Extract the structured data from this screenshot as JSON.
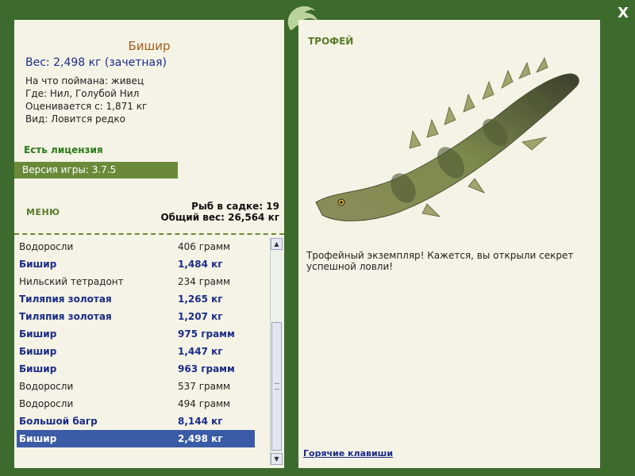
{
  "window": {
    "close_label": "X"
  },
  "fish": {
    "name": "Бишир",
    "weight": "Вес: 2,498 кг (зачетная)",
    "caught_on": "На что поймана: живец",
    "location": "Где: Нил, Голубой Нил",
    "valued_from": "Оценивается с: 1,871 кг",
    "rarity": "Вид: Ловится редко"
  },
  "license": "Есть лицензия",
  "version": "Версия игры: 3.7.5",
  "menu_label": "МЕНЮ",
  "stats": {
    "fish_in_keepnet": "Рыб в садке: 19",
    "total_weight": "Общий вес: 26,564 кг"
  },
  "list": [
    {
      "name": "Водоросли",
      "weight": "406 грамм",
      "style": "plain"
    },
    {
      "name": "Бишир",
      "weight": "1,484 кг",
      "style": "bold"
    },
    {
      "name": "Нильский тетрадонт",
      "weight": "234 грамм",
      "style": "plain"
    },
    {
      "name": "Тиляпия золотая",
      "weight": "1,265 кг",
      "style": "bold"
    },
    {
      "name": "Тиляпия золотая",
      "weight": "1,207 кг",
      "style": "bold"
    },
    {
      "name": "Бишир",
      "weight": "975 грамм",
      "style": "bold"
    },
    {
      "name": "Бишир",
      "weight": "1,447 кг",
      "style": "bold"
    },
    {
      "name": "Бишир",
      "weight": "963 грамм",
      "style": "bold"
    },
    {
      "name": "Водоросли",
      "weight": "537 грамм",
      "style": "plain"
    },
    {
      "name": "Водоросли",
      "weight": "494 грамм",
      "style": "plain"
    },
    {
      "name": "Большой багр",
      "weight": "8,144 кг",
      "style": "bold"
    },
    {
      "name": "Бишир",
      "weight": "2,498 кг",
      "style": "sel"
    }
  ],
  "trophy": {
    "title": "ТРОФЕЙ",
    "text": "Трофейный экземпляр! Кажется, вы открыли секрет успешной ловли!"
  },
  "hotkeys": "Горячие клавиши",
  "icons": {
    "logo": "lizard-logo-icon",
    "fish_image": "bichir-fish-image",
    "scroll_up": "arrow-up-icon",
    "scroll_down": "arrow-down-icon"
  }
}
